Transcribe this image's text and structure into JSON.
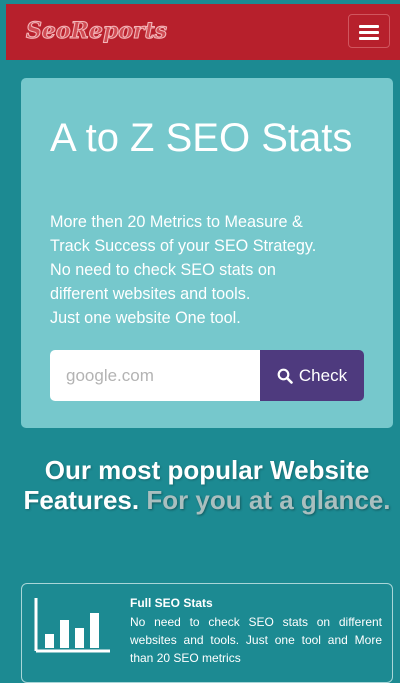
{
  "navbar": {
    "brand": "SeoReports",
    "menu_icon": "hamburger-menu-icon"
  },
  "hero": {
    "title": "A to Z SEO Stats",
    "subtitle_lines": [
      "More then 20 Metrics to Measure &",
      "Track Success of your SEO Strategy.",
      "No need to check SEO stats on",
      "different websites and tools.",
      "Just one website One tool."
    ],
    "search": {
      "placeholder": "google.com",
      "button_label": "Check",
      "button_icon": "search-icon"
    }
  },
  "features_section": {
    "title_main": "Our most popular Website Features.",
    "title_muted": "For you at a glance."
  },
  "feature_cards": [
    {
      "icon": "bar-chart-icon",
      "title": "Full SEO Stats",
      "text": "No need to check SEO stats on different websites and tools. Just one tool and More than 20 SEO metrics"
    }
  ],
  "colors": {
    "background": "#1c8a92",
    "navbar": "#b7202c",
    "hero": "#76c8cc",
    "button": "#4e3a7e"
  }
}
